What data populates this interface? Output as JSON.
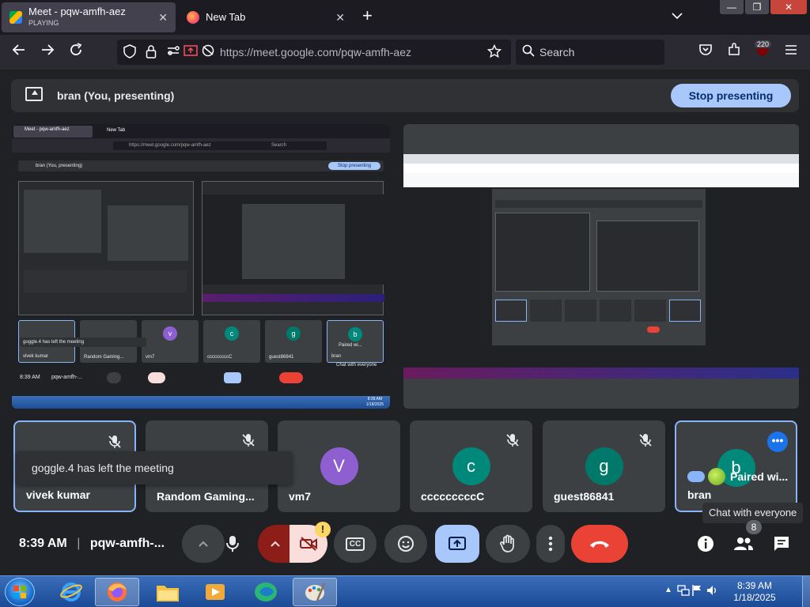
{
  "browser": {
    "tabs": [
      {
        "title": "Meet - pqw-amfh-aez",
        "subtitle": "PLAYING",
        "active": true
      },
      {
        "title": "New Tab",
        "active": false
      }
    ],
    "url": "https://meet.google.com/pqw-amfh-aez",
    "search_placeholder": "Search",
    "extension_badge": "220"
  },
  "meet": {
    "present_banner": "bran (You, presenting)",
    "stop_presenting": "Stop presenting",
    "participants": [
      {
        "name": "vivek kumar",
        "avatar": "",
        "color": "",
        "muted": true,
        "highlight": true
      },
      {
        "name": "Random Gaming...",
        "avatar": "",
        "color": "",
        "muted": true,
        "highlight": false
      },
      {
        "name": "vm7",
        "avatar": "V",
        "color": "#8e5fd1",
        "muted": false,
        "highlight": false
      },
      {
        "name": "cccccccccC",
        "avatar": "c",
        "color": "#00897b",
        "muted": true,
        "highlight": false
      },
      {
        "name": "guest86841",
        "avatar": "g",
        "color": "#00796b",
        "muted": true,
        "highlight": false
      },
      {
        "name": "bran",
        "avatar": "b",
        "color": "#00897b",
        "muted": false,
        "highlight": true
      }
    ],
    "toast": "goggle.4 has left the meeting",
    "paired_label": "Paired wi...",
    "tooltip": "Chat with everyone",
    "time": "8:39 AM",
    "meeting_code": "pqw-amfh-...",
    "people_count": "8",
    "warning_mark": "!",
    "cc_label": "CC",
    "mini": {
      "tab_title": "Meet - pqw-amfh-aez",
      "tab2": "New Tab",
      "url": "https://meet.google.com/pqw-amfh-aez",
      "search": "Search",
      "banner": "bran (You, presenting)",
      "stop": "Stop presenting",
      "toast": "goggle.4 has left the meeting",
      "names": [
        "vivek kumar",
        "Random Gaming...",
        "vm7",
        "cccccccccC",
        "guest86841",
        "bran"
      ],
      "avatars": [
        "",
        "",
        "v",
        "c",
        "g",
        "b"
      ],
      "paired": "Paired wi...",
      "time": "8:39 AM",
      "code": "pqw-amfh-...",
      "tooltip": "Chat with everyone",
      "tray_time": "8:39 AM",
      "tray_date": "1/18/2025"
    }
  },
  "taskbar": {
    "time": "8:39 AM",
    "date": "1/18/2025"
  },
  "colors": {
    "meet_bg": "#202124",
    "tile_bg": "#3c4043",
    "accent_blue": "#a8c7fa",
    "end_call_red": "#ea4335",
    "highlight_border": "#8ab4f8"
  }
}
